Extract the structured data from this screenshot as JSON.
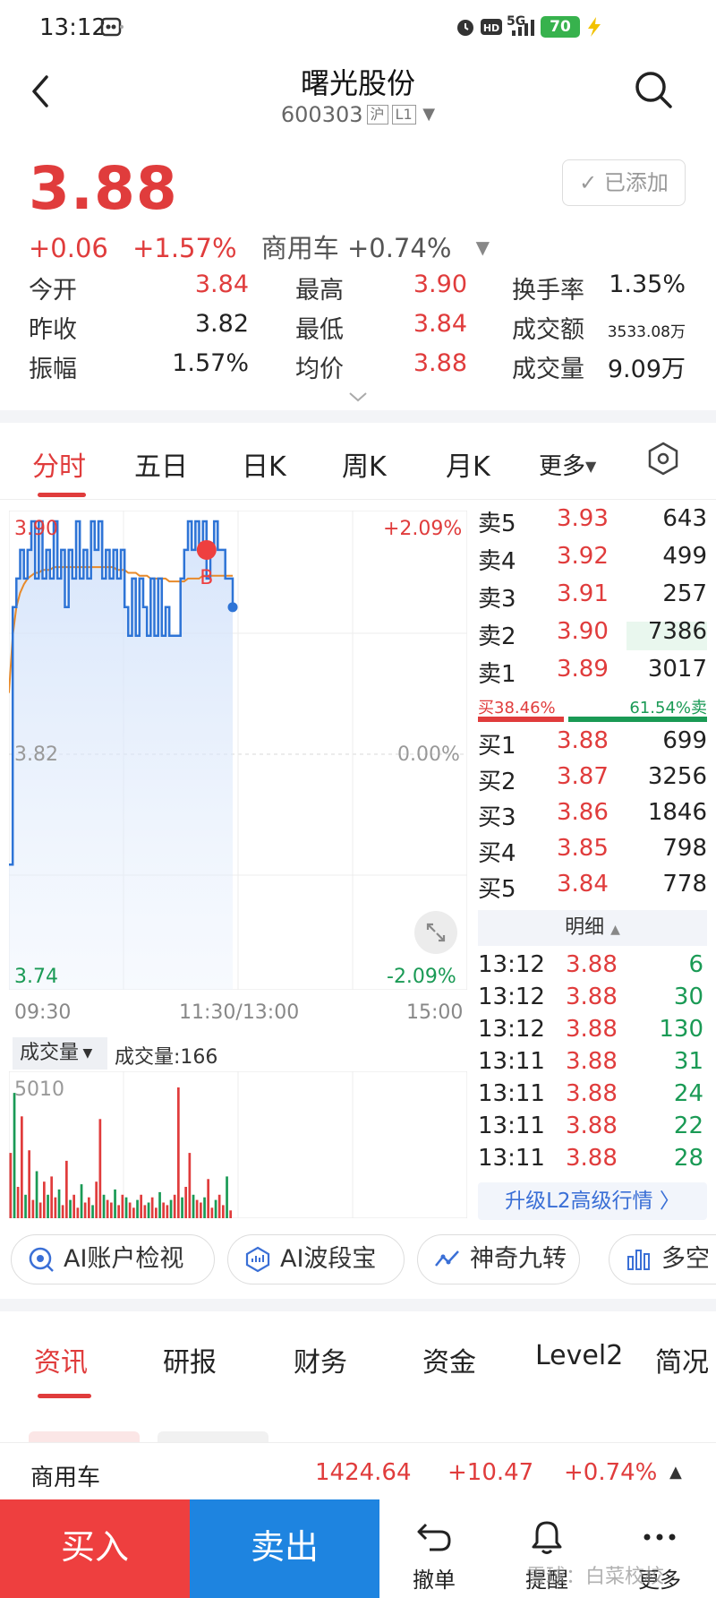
{
  "status_bar": {
    "time": "13:12",
    "network": "5G",
    "battery": "70"
  },
  "header": {
    "title": "曙光股份",
    "code": "600303",
    "exchange_tag": "沪",
    "level_tag": "L1"
  },
  "quote": {
    "price": "3.88",
    "change": "+0.06",
    "change_pct": "+1.57%",
    "sector": "商用车 +0.74%",
    "added_label": "已添加"
  },
  "stats": [
    [
      {
        "label": "今开",
        "value": "3.84",
        "color": "red"
      },
      {
        "label": "最高",
        "value": "3.90",
        "color": "red"
      },
      {
        "label": "换手率",
        "value": "1.35%",
        "color": "black"
      }
    ],
    [
      {
        "label": "昨收",
        "value": "3.82",
        "color": "black"
      },
      {
        "label": "最低",
        "value": "3.84",
        "color": "red"
      },
      {
        "label": "成交额",
        "value": "3533.08万",
        "color": "black"
      }
    ],
    [
      {
        "label": "振幅",
        "value": "1.57%",
        "color": "black"
      },
      {
        "label": "均价",
        "value": "3.88",
        "color": "red"
      },
      {
        "label": "成交量",
        "value": "9.09万",
        "color": "black"
      }
    ]
  ],
  "chart_tabs": [
    "分时",
    "五日",
    "日K",
    "周K",
    "月K",
    "更多"
  ],
  "chart": {
    "y_top": "3.90",
    "y_mid": "3.82",
    "y_bottom": "3.74",
    "pct_top": "+2.09%",
    "pct_mid": "0.00%",
    "pct_bottom": "-2.09%",
    "x_start": "09:30",
    "x_mid": "11:30/13:00",
    "x_end": "15:00",
    "marker_label": "B"
  },
  "chart_data": {
    "type": "line",
    "title": "",
    "ylim": [
      3.74,
      3.9
    ],
    "series": [
      {
        "values": [
          3.78,
          3.87,
          3.88,
          3.89,
          3.88,
          3.89,
          3.9,
          3.88,
          3.9,
          3.88,
          3.89,
          3.88,
          3.9,
          3.88,
          3.89,
          3.87,
          3.89,
          3.88,
          3.9,
          3.88,
          3.89,
          3.88,
          3.9,
          3.89,
          3.9,
          3.88,
          3.89,
          3.88,
          3.89,
          3.88,
          3.89,
          3.87,
          3.86,
          3.88,
          3.86,
          3.88,
          3.87,
          3.86,
          3.88,
          3.86,
          3.88,
          3.86,
          3.87,
          3.86,
          3.86,
          3.86,
          3.88,
          3.89,
          3.9,
          3.89,
          3.9,
          3.89,
          3.9,
          3.88,
          3.89,
          3.9,
          3.89,
          3.89,
          3.88,
          3.88,
          3.87
        ]
      },
      {
        "values": [
          3.84,
          3.86,
          3.87,
          3.875,
          3.878,
          3.88,
          3.881,
          3.882,
          3.882,
          3.883,
          3.883,
          3.883,
          3.884,
          3.884,
          3.884,
          3.884,
          3.884,
          3.884,
          3.884,
          3.884,
          3.884,
          3.884,
          3.884,
          3.884,
          3.884,
          3.884,
          3.884,
          3.884,
          3.884,
          3.883,
          3.883,
          3.883,
          3.882,
          3.882,
          3.882,
          3.881,
          3.881,
          3.881,
          3.88,
          3.88,
          3.88,
          3.88,
          3.88,
          3.879,
          3.879,
          3.879,
          3.879,
          3.879,
          3.88,
          3.88,
          3.88,
          3.88,
          3.881,
          3.881,
          3.881,
          3.881,
          3.881,
          3.881,
          3.881,
          3.881,
          3.881
        ]
      }
    ]
  },
  "volume": {
    "dropdown_label": "成交量",
    "label": "成交量:166",
    "y_max_label": "5010"
  },
  "volume_data": [
    2500,
    4800,
    1200,
    3900,
    900,
    2600,
    700,
    1800,
    600,
    1400,
    900,
    1600,
    800,
    1100,
    500,
    2200,
    700,
    900,
    400,
    1300,
    600,
    800,
    500,
    1400,
    3800,
    900,
    700,
    600,
    1100,
    500,
    900,
    800,
    600,
    400,
    700,
    900,
    500,
    600,
    800,
    400,
    1000,
    600,
    500,
    700,
    900,
    5010,
    800,
    1200,
    2500,
    900,
    700,
    600,
    800,
    1500,
    400,
    700,
    900,
    500,
    1600,
    300
  ],
  "order_book": {
    "asks": [
      {
        "label": "卖5",
        "price": "3.93",
        "vol": "643"
      },
      {
        "label": "卖4",
        "price": "3.92",
        "vol": "499"
      },
      {
        "label": "卖3",
        "price": "3.91",
        "vol": "257"
      },
      {
        "label": "卖2",
        "price": "3.90",
        "vol": "7386"
      },
      {
        "label": "卖1",
        "price": "3.89",
        "vol": "3017"
      }
    ],
    "buy_ratio": "买38.46%",
    "sell_ratio": "61.54%卖",
    "buy_frac": 0.3846,
    "bids": [
      {
        "label": "买1",
        "price": "3.88",
        "vol": "699"
      },
      {
        "label": "买2",
        "price": "3.87",
        "vol": "3256"
      },
      {
        "label": "买3",
        "price": "3.86",
        "vol": "1846"
      },
      {
        "label": "买4",
        "price": "3.85",
        "vol": "798"
      },
      {
        "label": "买5",
        "price": "3.84",
        "vol": "778"
      }
    ]
  },
  "detail": {
    "header": "明细",
    "ticks": [
      {
        "time": "13:12",
        "price": "3.88",
        "vol": "6"
      },
      {
        "time": "13:12",
        "price": "3.88",
        "vol": "30"
      },
      {
        "time": "13:12",
        "price": "3.88",
        "vol": "130"
      },
      {
        "time": "13:11",
        "price": "3.88",
        "vol": "31"
      },
      {
        "time": "13:11",
        "price": "3.88",
        "vol": "24"
      },
      {
        "time": "13:11",
        "price": "3.88",
        "vol": "22"
      },
      {
        "time": "13:11",
        "price": "3.88",
        "vol": "28"
      }
    ],
    "upgrade_label": "升级L2高级行情 〉"
  },
  "tools": [
    "AI账户检视",
    "AI波段宝",
    "神奇九转",
    "多空"
  ],
  "news_tabs": [
    "资讯",
    "研报",
    "财务",
    "资金",
    "Level2",
    "简况"
  ],
  "index_bar": {
    "name": "商用车",
    "value": "1424.64",
    "change": "+10.47",
    "change_pct": "+0.74%"
  },
  "bottom": {
    "buy": "买入",
    "sell": "卖出",
    "cancel": "撤单",
    "remind": "提醒",
    "more": "更多"
  },
  "watermark": "雪球：白菜校校"
}
